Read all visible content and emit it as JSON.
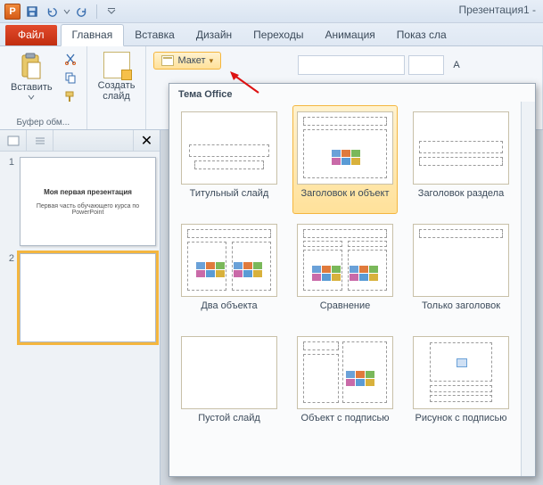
{
  "titlebar": {
    "doc_title": "Презентация1 -"
  },
  "tabs": {
    "file": "Файл",
    "items": [
      "Главная",
      "Вставка",
      "Дизайн",
      "Переходы",
      "Анимация",
      "Показ сла"
    ]
  },
  "ribbon": {
    "clipboard": {
      "paste": "Вставить",
      "group": "Буфер обм..."
    },
    "slides": {
      "new_slide_line1": "Создать",
      "new_slide_line2": "слайд",
      "layout": "Макет"
    }
  },
  "thumbs": {
    "items": [
      {
        "num": "1",
        "title": "Моя первая презентация",
        "sub": "Первая часть обучающего курса по PowerPoint"
      },
      {
        "num": "2",
        "title": "",
        "sub": ""
      }
    ]
  },
  "gallery": {
    "title": "Тема Office",
    "items": [
      "Титульный слайд",
      "Заголовок и объект",
      "Заголовок раздела",
      "Два объекта",
      "Сравнение",
      "Только заголовок",
      "Пустой слайд",
      "Объект с подписью",
      "Рисунок с подписью"
    ],
    "selected_index": 1
  }
}
